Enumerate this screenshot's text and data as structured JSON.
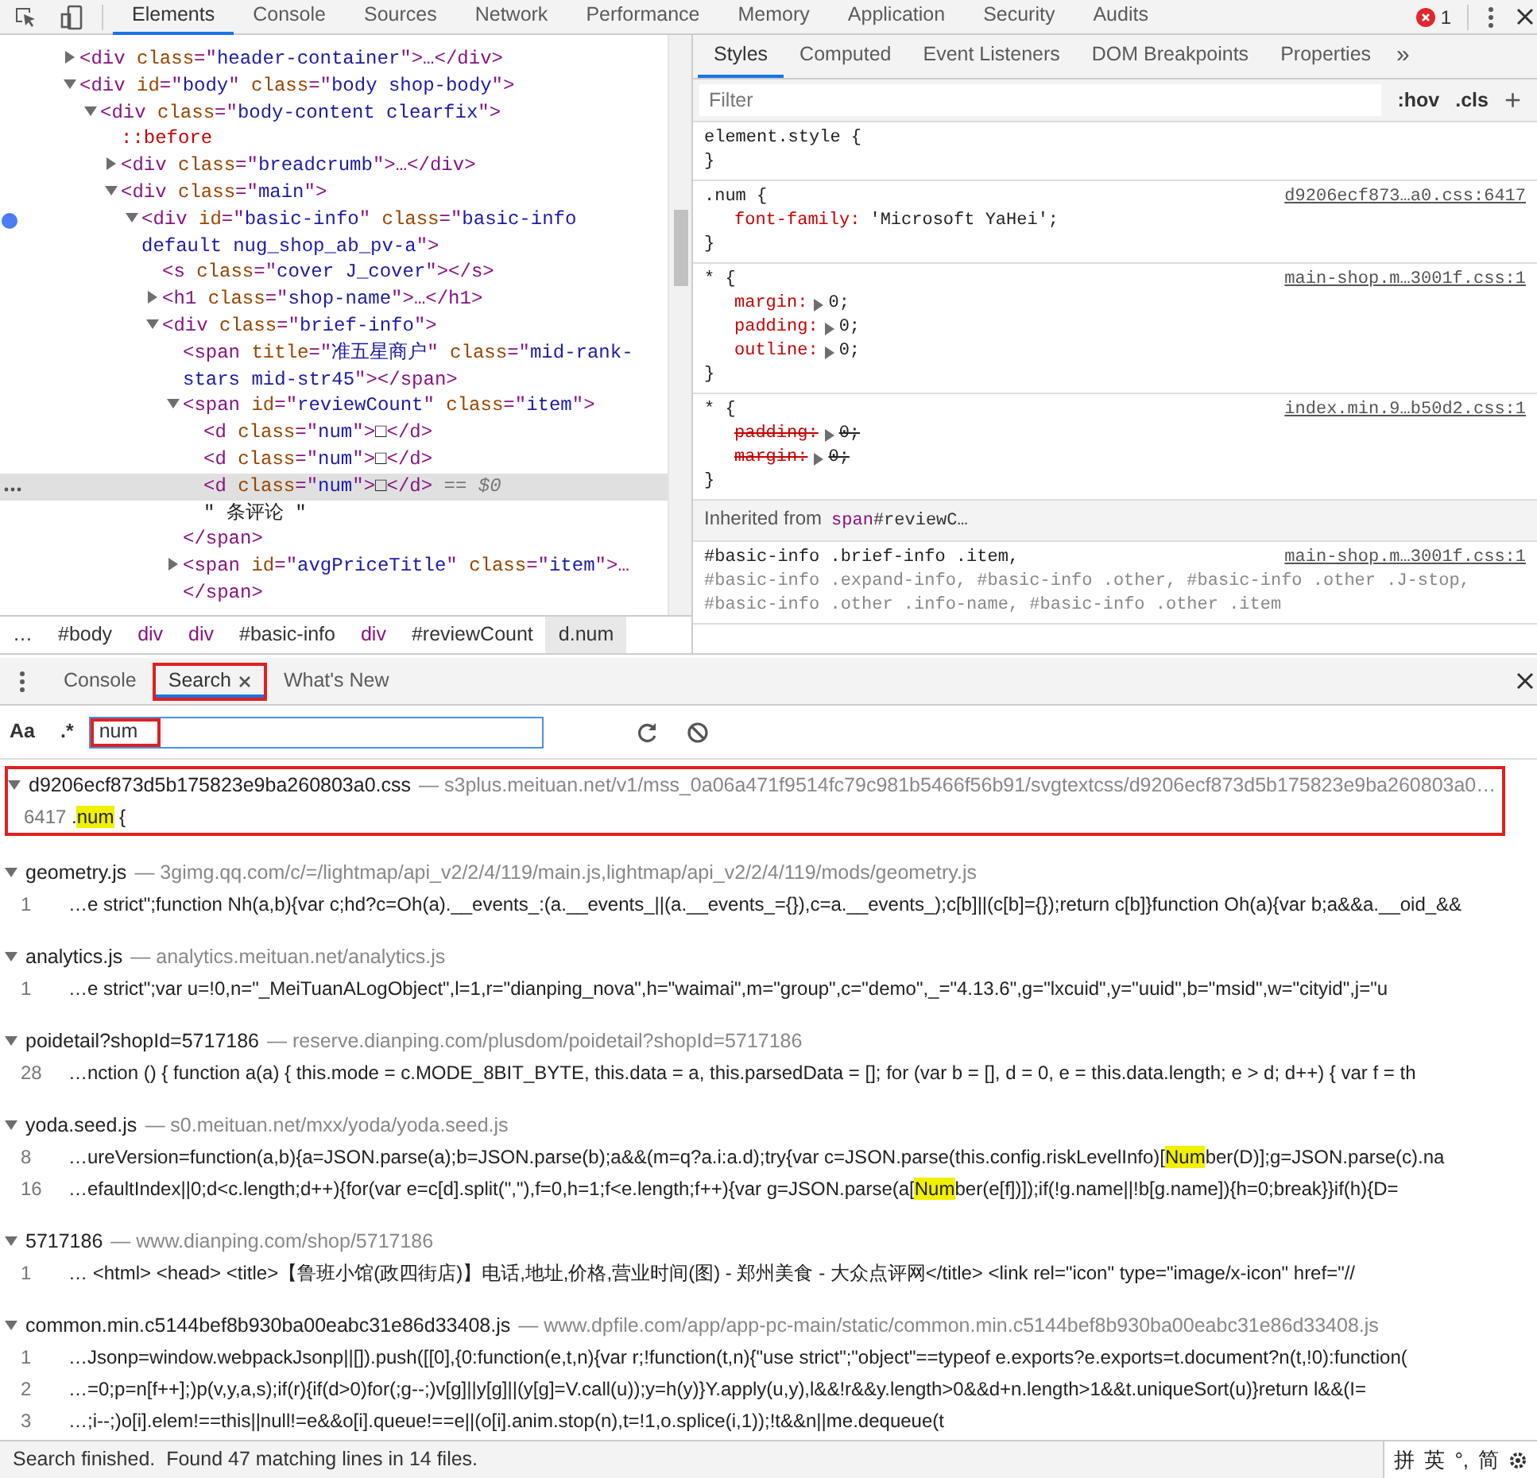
{
  "top_tabs": [
    {
      "label": "Elements",
      "selected": true
    },
    {
      "label": "Console",
      "selected": false
    },
    {
      "label": "Sources",
      "selected": false
    },
    {
      "label": "Network",
      "selected": false
    },
    {
      "label": "Performance",
      "selected": false
    },
    {
      "label": "Memory",
      "selected": false
    },
    {
      "label": "Application",
      "selected": false
    },
    {
      "label": "Security",
      "selected": false
    },
    {
      "label": "Audits",
      "selected": false
    }
  ],
  "error_count": "1",
  "dom_tree": [
    {
      "selected": false,
      "expanded": false,
      "tokens": [
        {
          "kind": "tag",
          "text": "<div "
        },
        {
          "kind": "attr",
          "text": "class"
        },
        {
          "kind": "tag",
          "text": "=\""
        },
        {
          "kind": "value",
          "text": "header-container"
        },
        {
          "kind": "tag",
          "text": "\">…</div>"
        }
      ]
    },
    {
      "selected": false,
      "expanded": true,
      "tokens": [
        {
          "kind": "tag",
          "text": "<div "
        },
        {
          "kind": "attr",
          "text": "id"
        },
        {
          "kind": "tag",
          "text": "=\""
        },
        {
          "kind": "value",
          "text": "body"
        },
        {
          "kind": "tag",
          "text": "\" "
        },
        {
          "kind": "attr",
          "text": "class"
        },
        {
          "kind": "tag",
          "text": "=\""
        },
        {
          "kind": "value",
          "text": "body shop-body"
        },
        {
          "kind": "tag",
          "text": "\">"
        }
      ],
      "children": [
        {
          "selected": false,
          "expanded": true,
          "tokens": [
            {
              "kind": "tag",
              "text": "<div "
            },
            {
              "kind": "attr",
              "text": "class"
            },
            {
              "kind": "tag",
              "text": "=\""
            },
            {
              "kind": "value",
              "text": "body-content clearfix"
            },
            {
              "kind": "tag",
              "text": "\">"
            }
          ],
          "children": [
            {
              "selected": false,
              "tokens": [
                {
                  "kind": "pseudo",
                  "text": "::before"
                }
              ]
            },
            {
              "selected": false,
              "expanded": false,
              "tokens": [
                {
                  "kind": "tag",
                  "text": "<div "
                },
                {
                  "kind": "attr",
                  "text": "class"
                },
                {
                  "kind": "tag",
                  "text": "=\""
                },
                {
                  "kind": "value",
                  "text": "breadcrumb"
                },
                {
                  "kind": "tag",
                  "text": "\">…</div>"
                }
              ]
            },
            {
              "selected": false,
              "expanded": true,
              "tokens": [
                {
                  "kind": "tag",
                  "text": "<div "
                },
                {
                  "kind": "attr",
                  "text": "class"
                },
                {
                  "kind": "tag",
                  "text": "=\""
                },
                {
                  "kind": "value",
                  "text": "main"
                },
                {
                  "kind": "tag",
                  "text": "\">"
                }
              ],
              "children": [
                {
                  "selected": false,
                  "expanded": true,
                  "breakpoint": true,
                  "tokens": [
                    {
                      "kind": "tag",
                      "text": "<div "
                    },
                    {
                      "kind": "attr",
                      "text": "id"
                    },
                    {
                      "kind": "tag",
                      "text": "=\""
                    },
                    {
                      "kind": "value",
                      "text": "basic-info"
                    },
                    {
                      "kind": "tag",
                      "text": "\" "
                    },
                    {
                      "kind": "attr",
                      "text": "class"
                    },
                    {
                      "kind": "tag",
                      "text": "=\""
                    },
                    {
                      "kind": "value",
                      "text": "basic-info default nug_shop_ab_pv-a"
                    },
                    {
                      "kind": "tag",
                      "text": "\">"
                    }
                  ],
                  "children": [
                    {
                      "selected": false,
                      "tokens": [
                        {
                          "kind": "tag",
                          "text": "<s "
                        },
                        {
                          "kind": "attr",
                          "text": "class"
                        },
                        {
                          "kind": "tag",
                          "text": "=\""
                        },
                        {
                          "kind": "value",
                          "text": "cover J_cover"
                        },
                        {
                          "kind": "tag",
                          "text": "\"></s>"
                        }
                      ]
                    },
                    {
                      "selected": false,
                      "expanded": false,
                      "tokens": [
                        {
                          "kind": "tag",
                          "text": "<h1 "
                        },
                        {
                          "kind": "attr",
                          "text": "class"
                        },
                        {
                          "kind": "tag",
                          "text": "=\""
                        },
                        {
                          "kind": "value",
                          "text": "shop-name"
                        },
                        {
                          "kind": "tag",
                          "text": "\">…</h1>"
                        }
                      ]
                    },
                    {
                      "selected": false,
                      "expanded": true,
                      "tokens": [
                        {
                          "kind": "tag",
                          "text": "<div "
                        },
                        {
                          "kind": "attr",
                          "text": "class"
                        },
                        {
                          "kind": "tag",
                          "text": "=\""
                        },
                        {
                          "kind": "value",
                          "text": "brief-info"
                        },
                        {
                          "kind": "tag",
                          "text": "\">"
                        }
                      ],
                      "children": [
                        {
                          "selected": false,
                          "tokens": [
                            {
                              "kind": "tag",
                              "text": "<span "
                            },
                            {
                              "kind": "attr",
                              "text": "title"
                            },
                            {
                              "kind": "tag",
                              "text": "=\""
                            },
                            {
                              "kind": "value",
                              "text": "准五星商户"
                            },
                            {
                              "kind": "tag",
                              "text": "\" "
                            },
                            {
                              "kind": "attr",
                              "text": "class"
                            },
                            {
                              "kind": "tag",
                              "text": "=\""
                            },
                            {
                              "kind": "value",
                              "text": "mid-rank-stars mid-str45"
                            },
                            {
                              "kind": "tag",
                              "text": "\"></span>"
                            }
                          ]
                        },
                        {
                          "selected": false,
                          "expanded": true,
                          "close": "</span>",
                          "tokens": [
                            {
                              "kind": "tag",
                              "text": "<span "
                            },
                            {
                              "kind": "attr",
                              "text": "id"
                            },
                            {
                              "kind": "tag",
                              "text": "=\""
                            },
                            {
                              "kind": "value",
                              "text": "reviewCount"
                            },
                            {
                              "kind": "tag",
                              "text": "\" "
                            },
                            {
                              "kind": "attr",
                              "text": "class"
                            },
                            {
                              "kind": "tag",
                              "text": "=\""
                            },
                            {
                              "kind": "value",
                              "text": "item"
                            },
                            {
                              "kind": "tag",
                              "text": "\">"
                            }
                          ],
                          "children": [
                            {
                              "selected": false,
                              "tokens": [
                                {
                                  "kind": "tag",
                                  "text": "<d "
                                },
                                {
                                  "kind": "attr",
                                  "text": "class"
                                },
                                {
                                  "kind": "tag",
                                  "text": "=\""
                                },
                                {
                                  "kind": "value",
                                  "text": "num"
                                },
                                {
                                  "kind": "tag",
                                  "text": "\">"
                                },
                                {
                                  "kind": "text",
                                  "text": "□"
                                },
                                {
                                  "kind": "tag",
                                  "text": "</d>"
                                }
                              ]
                            },
                            {
                              "selected": false,
                              "tokens": [
                                {
                                  "kind": "tag",
                                  "text": "<d "
                                },
                                {
                                  "kind": "attr",
                                  "text": "class"
                                },
                                {
                                  "kind": "tag",
                                  "text": "=\""
                                },
                                {
                                  "kind": "value",
                                  "text": "num"
                                },
                                {
                                  "kind": "tag",
                                  "text": "\">"
                                },
                                {
                                  "kind": "text",
                                  "text": "□"
                                },
                                {
                                  "kind": "tag",
                                  "text": "</d>"
                                }
                              ]
                            },
                            {
                              "selected": true,
                              "tokens": [
                                {
                                  "kind": "tag",
                                  "text": "<d "
                                },
                                {
                                  "kind": "attr",
                                  "text": "class"
                                },
                                {
                                  "kind": "tag",
                                  "text": "=\""
                                },
                                {
                                  "kind": "value",
                                  "text": "num"
                                },
                                {
                                  "kind": "tag",
                                  "text": "\">"
                                },
                                {
                                  "kind": "text",
                                  "text": "□"
                                },
                                {
                                  "kind": "tag",
                                  "text": "</d>"
                                },
                                {
                                  "kind": "ref",
                                  "text": " == $0"
                                }
                              ]
                            },
                            {
                              "selected": false,
                              "tokens": [
                                {
                                  "kind": "text",
                                  "text": "\" 条评论 \""
                                }
                              ]
                            }
                          ]
                        },
                        {
                          "selected": false,
                          "expanded": false,
                          "tokens": [
                            {
                              "kind": "tag",
                              "text": "<span "
                            },
                            {
                              "kind": "attr",
                              "text": "id"
                            },
                            {
                              "kind": "tag",
                              "text": "=\""
                            },
                            {
                              "kind": "value",
                              "text": "avgPriceTitle"
                            },
                            {
                              "kind": "tag",
                              "text": "\" "
                            },
                            {
                              "kind": "attr",
                              "text": "class"
                            },
                            {
                              "kind": "tag",
                              "text": "=\""
                            },
                            {
                              "kind": "value",
                              "text": "item"
                            },
                            {
                              "kind": "tag",
                              "text": "\">… </span>"
                            }
                          ]
                        }
                      ]
                    }
                  ]
                }
              ]
            }
          ]
        }
      ]
    }
  ],
  "breadcrumbs": [
    {
      "label": "…",
      "kind": "text",
      "selected": false
    },
    {
      "label": "#body",
      "kind": "id",
      "selected": false
    },
    {
      "label": "div",
      "kind": "tag",
      "selected": false
    },
    {
      "label": "div",
      "kind": "tag",
      "selected": false
    },
    {
      "label": "#basic-info",
      "kind": "id",
      "selected": false
    },
    {
      "label": "div",
      "kind": "tag",
      "selected": false
    },
    {
      "label": "#reviewCount",
      "kind": "id",
      "selected": false
    },
    {
      "label": "d.num",
      "kind": "text",
      "selected": true
    }
  ],
  "side_tabs": [
    {
      "label": "Styles",
      "selected": true
    },
    {
      "label": "Computed",
      "selected": false
    },
    {
      "label": "Event Listeners",
      "selected": false
    },
    {
      "label": "DOM Breakpoints",
      "selected": false
    },
    {
      "label": "Properties",
      "selected": false
    }
  ],
  "side_more": "»",
  "filter": {
    "placeholder": "Filter"
  },
  "filter_buttons": [
    ":hov",
    ".cls",
    "+"
  ],
  "rules": [
    {
      "kind": "rule",
      "selector": [
        {
          "text": "element.style {",
          "matched": true
        }
      ],
      "close": "}"
    },
    {
      "kind": "rule",
      "selector": [
        {
          "text": ".num {",
          "matched": true
        }
      ],
      "source": "d9206ecf873…a0.css:6417",
      "properties": [
        {
          "name": "font-family:",
          "value": "'Microsoft YaHei';",
          "overridden": false
        }
      ],
      "close": "}"
    },
    {
      "kind": "rule",
      "selector": [
        {
          "text": "* {",
          "matched": true
        }
      ],
      "source": "main-shop.m…3001f.css:1",
      "properties": [
        {
          "name": "margin:",
          "value": "0;",
          "expandable": true,
          "overridden": false
        },
        {
          "name": "padding:",
          "value": "0;",
          "expandable": true,
          "overridden": false
        },
        {
          "name": "outline:",
          "value": "0;",
          "expandable": true,
          "overridden": false
        }
      ],
      "close": "}"
    },
    {
      "kind": "rule",
      "selector": [
        {
          "text": "* {",
          "matched": true
        }
      ],
      "source": "index.min.9…b50d2.css:1",
      "properties": [
        {
          "name": "padding:",
          "value": "0;",
          "expandable": true,
          "overridden": true
        },
        {
          "name": "margin:",
          "value": "0;",
          "expandable": true,
          "overridden": true
        }
      ],
      "close": "}"
    },
    {
      "kind": "inherited",
      "label": "Inherited from",
      "tag": "span",
      "id": "#reviewC…"
    },
    {
      "kind": "rule",
      "selector": [
        {
          "text": "#basic-info .brief-info .item,",
          "matched": true
        },
        {
          "text": "#basic-info .expand-info,",
          "matched": false
        },
        {
          "text": "#basic-info .other,",
          "matched": false
        },
        {
          "text": "#basic-info .other .J-stop,",
          "matched": false
        },
        {
          "text": "#basic-info .other .info-name,",
          "matched": false
        },
        {
          "text": "#basic-info .other .item",
          "matched": false
        }
      ],
      "source": "main-shop.m…3001f.css:1"
    }
  ],
  "drawer_tabs": [
    {
      "label": "Console",
      "selected": false
    },
    {
      "label": "Search",
      "selected": true,
      "closable": true,
      "annotated": true
    },
    {
      "label": "What's New",
      "selected": false
    }
  ],
  "search": {
    "case_toggle": "Aa",
    "regex_toggle": ".*",
    "value": "num",
    "value_annotated": true
  },
  "results": [
    {
      "file": "d9206ecf873d5b175823e9ba260803a0.css",
      "url": "— s3plus.meituan.net/v1/mss_0a06a471f9514fc79c981b5466f56b91/svgtextcss/d9206ecf873d5b175823e9ba260803a0…",
      "annotated": true,
      "lines": [
        {
          "number": "6417",
          "before": ".",
          "match": "num",
          "after": " {"
        }
      ]
    },
    {
      "file": "geometry.js",
      "url": "— 3gimg.qq.com/c/=/lightmap/api_v2/2/4/119/main.js,lightmap/api_v2/2/4/119/mods/geometry.js",
      "lines": [
        {
          "number": "1",
          "before": "…e strict\";function Nh(a,b){var c;hd?c=Oh(a).__events_:(a.__events_||(a.__events_={}),c=a.__events_);c[b]||(c[b]={});return c[b]}function Oh(a){var b;a&&a.__oid_&&"
        }
      ]
    },
    {
      "file": "analytics.js",
      "url": "— analytics.meituan.net/analytics.js",
      "lines": [
        {
          "number": "1",
          "before": "…e strict\";var u=!0,n=\"_MeiTuanALogObject\",l=1,r=\"dianping_nova\",h=\"waimai\",m=\"group\",c=\"demo\",_=\"4.13.6\",g=\"lxcuid\",y=\"uuid\",b=\"msid\",w=\"cityid\",j=\"u"
        }
      ]
    },
    {
      "file": "poidetail?shopId=5717186",
      "url": "— reserve.dianping.com/plusdom/poidetail?shopId=5717186",
      "lines": [
        {
          "number": "28",
          "before": "…nction () { function a(a) { this.mode = c.MODE_8BIT_BYTE, this.data = a, this.parsedData = []; for (var b = [], d = 0, e = this.data.length; e > d; d++) { var f = th"
        }
      ]
    },
    {
      "file": "yoda.seed.js",
      "url": "— s0.meituan.net/mxx/yoda/yoda.seed.js",
      "lines": [
        {
          "number": "8",
          "before": "…ureVersion=function(a,b){a=JSON.parse(a);b=JSON.parse(b);a&&(m=q?a.i:a.d);try{var c=JSON.parse(this.config.riskLevelInfo)[",
          "match": "Num",
          "after": "ber(D)];g=JSON.parse(c).na"
        },
        {
          "number": "16",
          "before": "…efaultIndex||0;d<c.length;d++){for(var e=c[d].split(\",\"),f=0,h=1;f<e.length;f++){var g=JSON.parse(a[",
          "match": "Num",
          "after": "ber(e[f])]);if(!g.name||!b[g.name]){h=0;break}}if(h){D="
        }
      ]
    },
    {
      "file": "5717186",
      "url": "— www.dianping.com/shop/5717186",
      "lines": [
        {
          "number": "1",
          "before": "… <html> <head> <title>【鲁班小馆(政四街店)】电话,地址,价格,营业时间(图) - 郑州美食 - 大众点评网</title> <link rel=\"icon\" type=\"image/x-icon\" href=\"//"
        }
      ]
    },
    {
      "file": "common.min.c5144bef8b930ba00eabc31e86d33408.js",
      "url": "— www.dpfile.com/app/app-pc-main/static/common.min.c5144bef8b930ba00eabc31e86d33408.js",
      "lines": [
        {
          "number": "1",
          "before": "…Jsonp=window.webpackJsonp||[]).push([[0],{0:function(e,t,n){var r;!function(t,n){\"use strict\";\"object\"==typeof e.exports?e.exports=t.document?n(t,!0):function("
        },
        {
          "number": "2",
          "before": "…=0;p=n[f++];)p(v,y,a,s);if(r){if(d>0)for(;g--;)v[g]||y[g]||(y[g]=V.call(u));y=h(y)}Y.apply(u,y),l&&!r&&y.length>0&&d+n.length>1&&t.uniqueSort(u)}return l&&(I="
        },
        {
          "number": "3",
          "before": "…;i--;)o[i].elem!==this||null!=e&&o[i].queue!==e||(o[i].anim.stop(n),t=!1,o.splice(i,1));!t&&n||me.dequeue(t"
        }
      ]
    }
  ],
  "status": "Search finished.  Found 47 matching lines in 14 files.",
  "ime": [
    "拼",
    "英",
    "°,",
    "简"
  ]
}
